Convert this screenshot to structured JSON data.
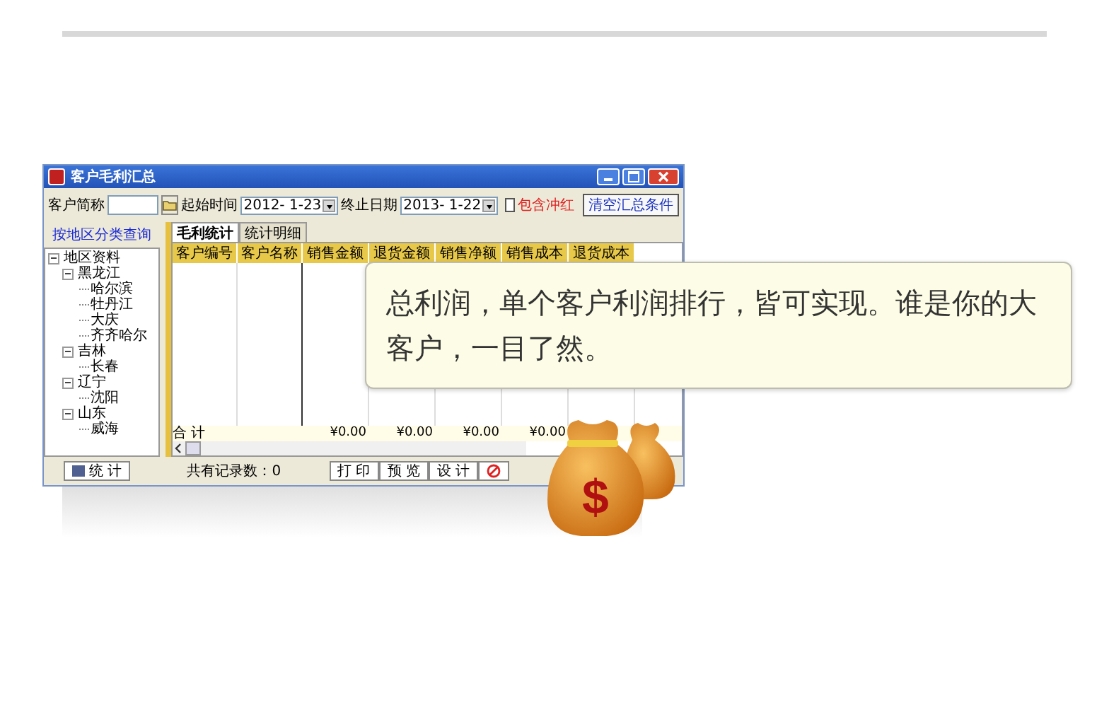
{
  "window": {
    "title": "客户毛利汇总"
  },
  "filters": {
    "customer_label": "客户简称",
    "start_label": "起始时间",
    "start_value": "2012- 1-23",
    "end_label": "终止日期",
    "end_value": "2013- 1-22",
    "include_label": "包含冲红",
    "include_checked": false,
    "clear_button": "清空汇总条件"
  },
  "sidebar": {
    "title": "按地区分类查询",
    "tree": [
      {
        "label": "地区资料",
        "expanded": true,
        "children": [
          {
            "label": "黑龙江",
            "expanded": true,
            "children": [
              {
                "label": "哈尔滨"
              },
              {
                "label": "牡丹江"
              },
              {
                "label": "大庆"
              },
              {
                "label": "齐齐哈尔"
              }
            ]
          },
          {
            "label": "吉林",
            "expanded": true,
            "children": [
              {
                "label": "长春"
              }
            ]
          },
          {
            "label": "辽宁",
            "expanded": true,
            "children": [
              {
                "label": "沈阳"
              }
            ]
          },
          {
            "label": "山东",
            "expanded": true,
            "children": [
              {
                "label": "威海"
              }
            ]
          }
        ]
      }
    ]
  },
  "tabs": [
    {
      "label": "毛利统计",
      "selected": true
    },
    {
      "label": "统计明细",
      "selected": false
    }
  ],
  "table": {
    "columns": [
      "客户编号",
      "客户名称",
      "销售金额",
      "退货金额",
      "销售净额",
      "销售成本",
      "退货成本"
    ],
    "total_label": "合 计",
    "total_amounts": [
      "¥0.00",
      "¥0.00",
      "¥0.00",
      "¥0.00"
    ]
  },
  "bottom": {
    "stats_button": "统 计",
    "record_count": "共有记录数：0",
    "print_button": "打 印",
    "preview_button": "预 览",
    "design_button": "设 计"
  },
  "callout": {
    "text": "总利润，单个客户利润排行，皆可实现。谁是你的大客户，一目了然。"
  },
  "bag_symbol": "$"
}
